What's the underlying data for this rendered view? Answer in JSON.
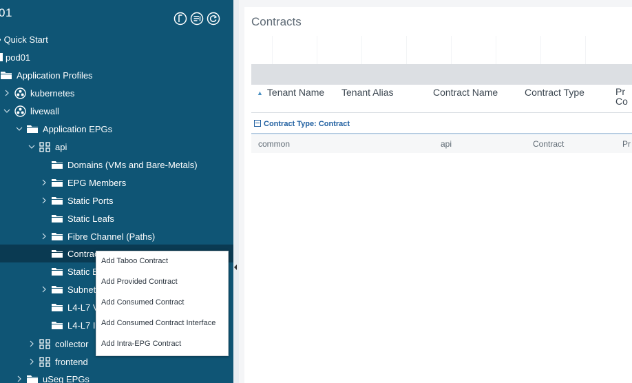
{
  "sidebar": {
    "title": "01",
    "tree": {
      "quick_start": "Quick Start",
      "pod01": "pod01",
      "application_profiles": "Application Profiles",
      "kubernetes": "kubernetes",
      "livewall": "livewall",
      "application_epgs": "Application EPGs",
      "api": "api",
      "domains": "Domains (VMs and Bare-Metals)",
      "epg_members": "EPG Members",
      "static_ports": "Static Ports",
      "static_leafs": "Static Leafs",
      "fibre_channel": "Fibre Channel (Paths)",
      "contracts": "Contracts",
      "static_e": "Static E",
      "subnets": "Subnets",
      "l4l7_a": "L4-L7 V",
      "l4l7_b": "L4-L7 I",
      "collector": "collector",
      "frontend": "frontend",
      "useg_epgs": "uSeg EPGs"
    }
  },
  "main": {
    "title": "Contracts",
    "columns": [
      "Tenant Name",
      "Tenant Alias",
      "Contract Name",
      "Contract Type",
      "Pr",
      "Co"
    ],
    "group_label": "Contract Type: Contract",
    "rows": [
      {
        "tenant_name": "common",
        "tenant_alias": "",
        "contract_name": "api",
        "contract_type": "Contract",
        "provider": "Pr"
      }
    ]
  },
  "context_menu": {
    "items": [
      "Add Taboo Contract",
      "Add Provided Contract",
      "Add Consumed Contract",
      "Add Consumed Contract Interface",
      "Add Intra-EPG Contract"
    ]
  }
}
